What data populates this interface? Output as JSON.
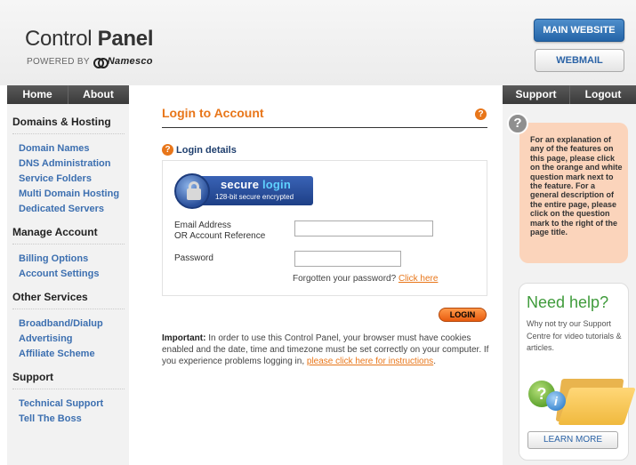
{
  "header": {
    "title_regular": "Control",
    "title_bold": "Panel",
    "powered_by": "POWERED BY",
    "brand": "Namesco",
    "main_website_label": "MAIN WEBSITE",
    "webmail_label": "WEBMAIL"
  },
  "nav_left": [
    {
      "label": "Home"
    },
    {
      "label": "About"
    }
  ],
  "nav_right": [
    {
      "label": "Support"
    },
    {
      "label": "Logout"
    }
  ],
  "sidebar": {
    "sections": [
      {
        "title": "Domains & Hosting",
        "links": [
          "Domain Names",
          "DNS Administration",
          "Service Folders",
          "Multi Domain Hosting",
          "Dedicated Servers"
        ]
      },
      {
        "title": "Manage Account",
        "links": [
          "Billing Options",
          "Account Settings"
        ]
      },
      {
        "title": "Other Services",
        "links": [
          "Broadband/Dialup",
          "Advertising",
          "Affiliate Scheme"
        ]
      },
      {
        "title": "Support",
        "links": [
          "Technical Support",
          "Tell The Boss"
        ]
      }
    ]
  },
  "main": {
    "title": "Login to Account",
    "details_label": "Login details",
    "secure_badge_line1_a": "secure",
    "secure_badge_line1_b": "login",
    "secure_badge_line2": "128-bit secure encrypted",
    "email_label_1": "Email Address",
    "email_label_2": "OR Account Reference",
    "email_value": "",
    "password_label": "Password",
    "password_value": "",
    "forgot_text": "Forgotten your password?",
    "forgot_link": "Click here",
    "login_button": "LOGIN",
    "notice_bold": "Important:",
    "notice_text": "In order to use this Control Panel, your browser must have cookies enabled and the date, time and timezone must be set correctly on your computer. If you experience problems logging in,",
    "notice_link": "please click here for instructions",
    "notice_end": "."
  },
  "help_icon_glyph": "?",
  "info_panel": {
    "icon_glyph": "?",
    "text": "For an explanation of any of the features on this page, please click on the orange and white question mark next to the feature. For a general description of the entire page, please click on the question mark to the right of the page title."
  },
  "help_card": {
    "title": "Need help?",
    "text": "Why not try our Support Centre for video tutorials & articles.",
    "button": "LEARN MORE"
  },
  "colors": {
    "accent_orange": "#e8761a",
    "link_blue": "#3c6fb0",
    "help_green": "#3f9b3b",
    "info_peach": "#fbd4bb"
  }
}
